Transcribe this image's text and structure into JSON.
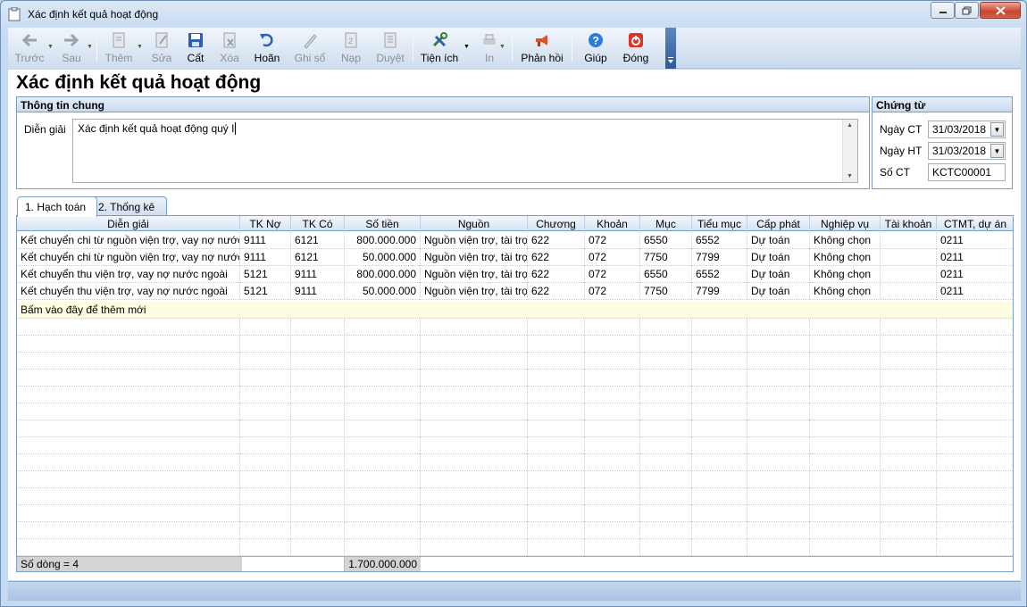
{
  "window": {
    "title": "Xác định kết quả hoạt động"
  },
  "toolbar": {
    "items": [
      {
        "label": "Trước",
        "icon": "arrow-left-icon",
        "enabled": false
      },
      {
        "label": "Sau",
        "icon": "arrow-right-icon",
        "enabled": false
      },
      {
        "label": "Thêm",
        "icon": "add-document-icon",
        "enabled": false
      },
      {
        "label": "Sửa",
        "icon": "edit-document-icon",
        "enabled": false
      },
      {
        "label": "Cất",
        "icon": "floppy-disk-icon",
        "enabled": true
      },
      {
        "label": "Xóa",
        "icon": "delete-document-icon",
        "enabled": false
      },
      {
        "label": "Hoãn",
        "icon": "undo-icon",
        "enabled": true
      },
      {
        "label": "Ghi sổ",
        "icon": "pencil-icon",
        "enabled": false
      },
      {
        "label": "Nạp",
        "icon": "reload-document-icon",
        "enabled": false
      },
      {
        "label": "Duyệt",
        "icon": "approve-document-icon",
        "enabled": false
      },
      {
        "label": "Tiện ích",
        "icon": "tools-icon",
        "enabled": true
      },
      {
        "label": "In",
        "icon": "printer-icon",
        "enabled": false
      },
      {
        "label": "Phản hồi",
        "icon": "megaphone-icon",
        "enabled": true
      },
      {
        "label": "Giúp",
        "icon": "help-icon",
        "enabled": true
      },
      {
        "label": "Đóng",
        "icon": "power-icon",
        "enabled": true
      }
    ]
  },
  "page": {
    "title": "Xác định kết quả hoạt động"
  },
  "general": {
    "header": "Thông tin chung",
    "description_label": "Diễn giải",
    "description_value": "Xác định kết quả hoạt động quý I"
  },
  "voucher": {
    "header": "Chứng từ",
    "doc_date_label": "Ngày CT",
    "doc_date": "31/03/2018",
    "post_date_label": "Ngày HT",
    "post_date": "31/03/2018",
    "number_label": "Số CT",
    "number": "KCTC00001"
  },
  "tabs": [
    {
      "label": "1. Hạch toán",
      "active": true
    },
    {
      "label": "2. Thống kê",
      "active": false
    }
  ],
  "grid": {
    "columns": [
      "Diễn giải",
      "TK Nợ",
      "TK Có",
      "Số tiền",
      "Nguồn",
      "Chương",
      "Khoản",
      "Mục",
      "Tiểu mục",
      "Cấp phát",
      "Nghiệp vụ",
      "Tài khoản",
      "CTMT, dự án"
    ],
    "rows": [
      [
        "Kết chuyển chi từ nguồn viện trợ, vay nợ nước...",
        "9111",
        "6121",
        "800.000.000",
        "Nguồn viện trợ, tài trợ",
        "622",
        "072",
        "6550",
        "6552",
        "Dự toán",
        "Không chọn",
        "",
        "0211"
      ],
      [
        "Kết chuyển chi từ nguồn viện trợ, vay nợ nước...",
        "9111",
        "6121",
        "50.000.000",
        "Nguồn viện trợ, tài trợ",
        "622",
        "072",
        "7750",
        "7799",
        "Dự toán",
        "Không chọn",
        "",
        "0211"
      ],
      [
        "Kết chuyển thu viện trợ, vay nợ nước ngoài",
        "5121",
        "9111",
        "800.000.000",
        "Nguồn viện trợ, tài trợ",
        "622",
        "072",
        "6550",
        "6552",
        "Dự toán",
        "Không chọn",
        "",
        "0211"
      ],
      [
        "Kết chuyển thu viện trợ, vay nợ nước ngoài",
        "5121",
        "9111",
        "50.000.000",
        "Nguồn viện trợ, tài trợ",
        "622",
        "072",
        "7750",
        "7799",
        "Dự toán",
        "Không chọn",
        "",
        "0211"
      ]
    ],
    "add_row_text": "Bấm vào đây để thêm mới",
    "footer_count": "Số dòng = 4",
    "footer_total": "1.700.000.000"
  }
}
